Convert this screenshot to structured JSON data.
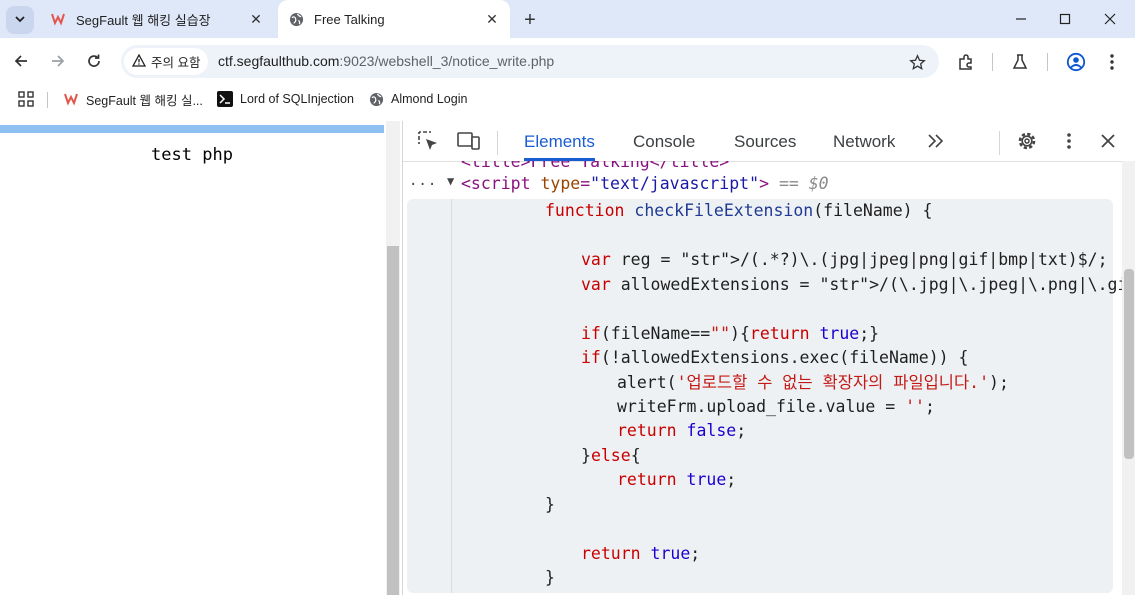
{
  "tabs": [
    {
      "title": "SegFault 웹 해킹 실습장",
      "active": false
    },
    {
      "title": "Free Talking",
      "active": true
    }
  ],
  "address_bar": {
    "security_chip": "주의 요함",
    "url_host": "ctf.segfaulthub.com",
    "url_path": ":9023/webshell_3/notice_write.php"
  },
  "bookmarks": [
    {
      "label": "SegFault 웹 해킹 실...",
      "icon": "segfault-logo-icon"
    },
    {
      "label": "Lord of SQLInjection",
      "icon": "terminal-icon"
    },
    {
      "label": "Almond Login",
      "icon": "globe-icon"
    }
  ],
  "page": {
    "body_text": "test php"
  },
  "devtools": {
    "tabs": [
      "Elements",
      "Console",
      "Sources",
      "Network"
    ],
    "active_tab": "Elements",
    "more_tabs": "»",
    "cut_line": "<title>Free Talking</title>",
    "dots": "...",
    "script_tag_open": "<script",
    "script_attr_name": "type",
    "script_attr_value": "\"text/javascript\"",
    "script_tag_close": ">",
    "selected_marker": "== $0",
    "code_lines": [
      "function checkFileExtension(fileName) {",
      "",
      "var reg = /(.*?)\\.(jpg|jpeg|png|gif|bmp|txt)$/;",
      "var allowedExtensions = /(\\.jpg|\\.jpeg|\\.png|\\.gif)$/i;",
      "",
      "if(fileName==\"\"){return true;}",
      "if(!allowedExtensions.exec(fileName)) {",
      "alert('업로드할 수 없는 확장자의 파일입니다.');",
      "writeFrm.upload_file.value = '';",
      "return false;",
      "}else{",
      "return true;",
      "}",
      "",
      "return true;",
      "}"
    ]
  },
  "colors": {
    "tabstrip_bg": "#dfe8f8",
    "active_devtools_tab": "#1a5cd1",
    "page_bar": "#8ec0f2",
    "code_bg": "#eef1f4"
  }
}
